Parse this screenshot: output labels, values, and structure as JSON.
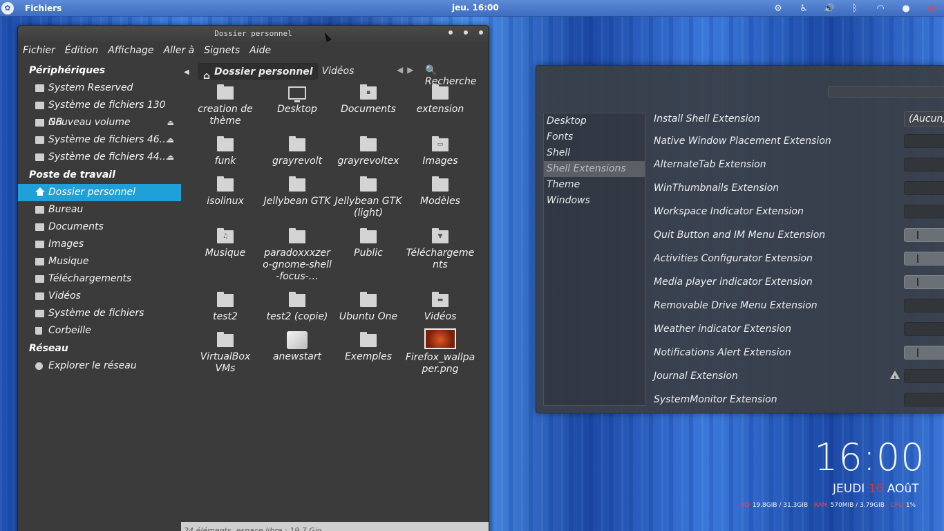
{
  "topbar": {
    "app": "Fichiers",
    "clock": "jeu. 16:00"
  },
  "fm": {
    "title": "Dossier personnel",
    "menu": [
      "Fichier",
      "Édition",
      "Affichage",
      "Aller à",
      "Signets",
      "Aide"
    ],
    "sidebar": {
      "devices_header": "Périphériques",
      "devices": [
        "System Reserved",
        "Système de fichiers 130 GB",
        "Nouveau volume",
        "Système de fichiers 46…",
        "Système de fichiers 44…"
      ],
      "places_header": "Poste de travail",
      "places": [
        "Dossier personnel",
        "Bureau",
        "Documents",
        "Images",
        "Musique",
        "Téléchargements",
        "Vidéos",
        "Système de fichiers",
        "Corbeille"
      ],
      "network_header": "Réseau",
      "network": [
        "Explorer le réseau"
      ]
    },
    "path": [
      "Dossier personnel",
      "Vidéos"
    ],
    "search_label": "Recherche",
    "items": [
      "creation de thème",
      "Desktop",
      "Documents",
      "extension",
      "funk",
      "grayrevolt",
      "grayrevoltex",
      "Images",
      "isolinux",
      "Jellybean GTK",
      "Jellybean GTK (light)",
      "Modèles",
      "Musique",
      "paradoxxxzero-gnome-shell-focus-…",
      "Public",
      "Téléchargements",
      "test2",
      "test2 (copie)",
      "Ubuntu One",
      "Vidéos",
      "VirtualBox VMs",
      "anewstart",
      "Exemples",
      "Firefox_wallpaper.png"
    ],
    "status": "24 éléments, espace libre : 19,7 Gio"
  },
  "tweak": {
    "nav": [
      "Desktop",
      "Fonts",
      "Shell",
      "Shell Extensions",
      "Theme",
      "Windows"
    ],
    "rows": [
      "Install Shell Extension",
      "Native Window Placement Extension",
      "AlternateTab Extension",
      "WinThumbnails Extension",
      "Workspace Indicator Extension",
      "Quit Button and IM Menu Extension",
      "Activities Configurator Extension",
      "Media player indicator Extension",
      "Removable Drive Menu Extension",
      "Weather indicator Extension",
      "Notifications Alert Extension",
      "Journal Extension",
      "SystemMonitor Extension"
    ],
    "install_value": "(Aucun)"
  },
  "desklet": {
    "time": "16:00",
    "day": "JEUDI",
    "daynum": "16",
    "month": "AOûT",
    "hd_label": "HD",
    "hd": "19.8GIB / 31.3GIB",
    "ram_label": "RAM",
    "ram": "570MIB / 3.79GIB",
    "cpu_label": "CPU",
    "cpu": "1%"
  }
}
